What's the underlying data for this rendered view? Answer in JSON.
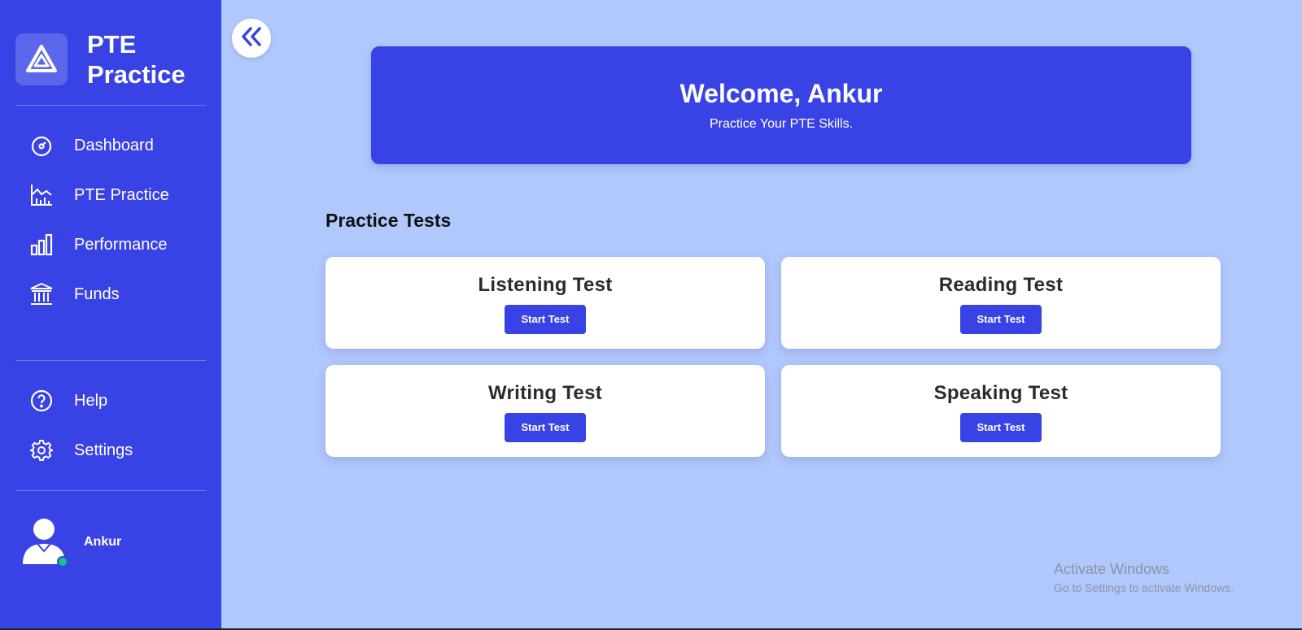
{
  "brand": {
    "name": "PTE Practice",
    "logo_icon": "triangle-logo-icon"
  },
  "sidebar": {
    "nav": [
      {
        "label": "Dashboard",
        "icon": "gauge-icon"
      },
      {
        "label": "PTE Practice",
        "icon": "line-chart-icon"
      },
      {
        "label": "Performance",
        "icon": "bar-chart-icon"
      },
      {
        "label": "Funds",
        "icon": "bank-icon"
      }
    ],
    "bottom_nav": [
      {
        "label": "Help",
        "icon": "help-circle-icon"
      },
      {
        "label": "Settings",
        "icon": "gear-icon"
      }
    ],
    "user": {
      "name": "Ankur",
      "status_color": "#17c38d"
    }
  },
  "collapse_icon": "double-chevron-left-icon",
  "banner": {
    "title": "Welcome, Ankur",
    "subtitle": "Practice Your PTE Skills."
  },
  "section_title": "Practice Tests",
  "tests": [
    {
      "title": "Listening Test",
      "button": "Start Test"
    },
    {
      "title": "Reading Test",
      "button": "Start Test"
    },
    {
      "title": "Writing Test",
      "button": "Start Test"
    },
    {
      "title": "Speaking Test",
      "button": "Start Test"
    }
  ],
  "watermark": {
    "line1": "Activate Windows",
    "line2": "Go to Settings to activate Windows."
  },
  "colors": {
    "primary": "#3943e5",
    "background": "#b1c8fd",
    "card": "#ffffff"
  }
}
